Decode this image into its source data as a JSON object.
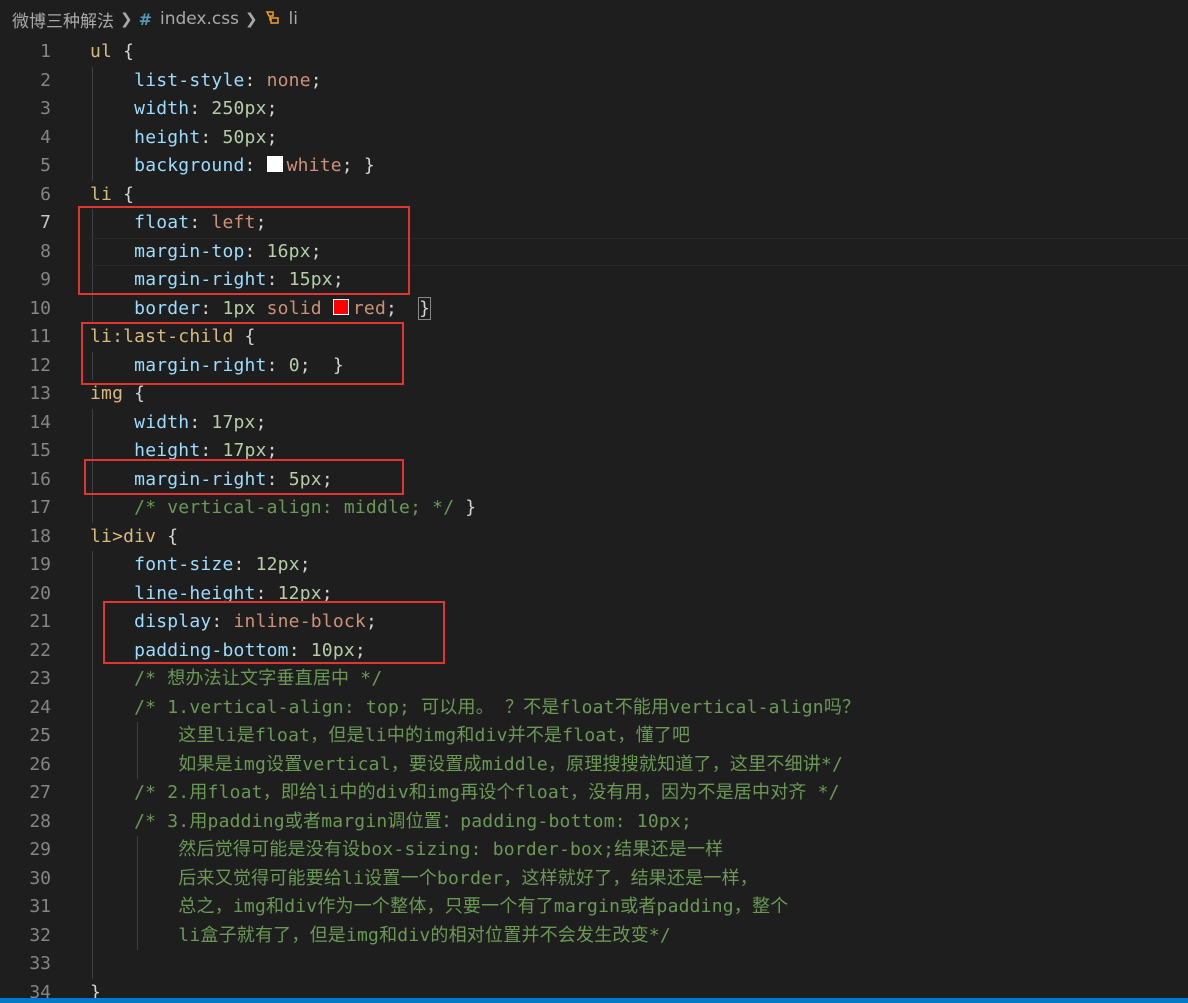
{
  "breadcrumb": {
    "folder": "微博三种解法",
    "file": "index.css",
    "symbol": "li",
    "file_icon": "hash-icon",
    "symbol_icon": "css-selector-icon"
  },
  "editor": {
    "lines": [
      {
        "n": "1",
        "text": "ul {"
      },
      {
        "n": "2",
        "text": "    list-style: none;"
      },
      {
        "n": "3",
        "text": "    width: 250px;"
      },
      {
        "n": "4",
        "text": "    height: 50px;"
      },
      {
        "n": "5",
        "text": "    background: white; }"
      },
      {
        "n": "6",
        "text": "li {"
      },
      {
        "n": "7",
        "text": "    float: left;"
      },
      {
        "n": "8",
        "text": "    margin-top: 16px;"
      },
      {
        "n": "9",
        "text": "    margin-right: 15px;"
      },
      {
        "n": "10",
        "text": "    border: 1px solid red;  }"
      },
      {
        "n": "11",
        "text": "li:last-child {"
      },
      {
        "n": "12",
        "text": "    margin-right: 0;  }"
      },
      {
        "n": "13",
        "text": "img {"
      },
      {
        "n": "14",
        "text": "    width: 17px;"
      },
      {
        "n": "15",
        "text": "    height: 17px;"
      },
      {
        "n": "16",
        "text": "    margin-right: 5px;"
      },
      {
        "n": "17",
        "text": "    /* vertical-align: middle; */ }"
      },
      {
        "n": "18",
        "text": "li>div {"
      },
      {
        "n": "19",
        "text": "    font-size: 12px;"
      },
      {
        "n": "20",
        "text": "    line-height: 12px;"
      },
      {
        "n": "21",
        "text": "    display: inline-block;"
      },
      {
        "n": "22",
        "text": "    padding-bottom: 10px;"
      },
      {
        "n": "23",
        "text": "    /* 想办法让文字垂直居中 */"
      },
      {
        "n": "24",
        "text": "    /* 1.vertical-align: top; 可以用。 ？不是float不能用vertical-align吗？"
      },
      {
        "n": "25",
        "text": "        这里li是float，但是li中的img和div并不是float，懂了吧"
      },
      {
        "n": "26",
        "text": "        如果是img设置vertical，要设置成middle，原理搜搜就知道了，这里不细讲*/"
      },
      {
        "n": "27",
        "text": "    /* 2.用float，即给li中的div和img再设个float，没有用，因为不是居中对齐 */"
      },
      {
        "n": "28",
        "text": "    /* 3.用padding或者margin调位置：padding-bottom: 10px;"
      },
      {
        "n": "29",
        "text": "        然后觉得可能是没有设box-sizing: border-box;结果还是一样"
      },
      {
        "n": "30",
        "text": "        后来又觉得可能要给li设置一个border，这样就好了，结果还是一样，"
      },
      {
        "n": "31",
        "text": "        总之，img和div作为一个整体，只要一个有了margin或者padding，整个"
      },
      {
        "n": "32",
        "text": "        li盒子就有了，但是img和div的相对位置并不会发生改变*/"
      },
      {
        "n": "33",
        "text": ""
      },
      {
        "n": "34",
        "text": "}"
      }
    ],
    "swatches": {
      "white": "#ffffff",
      "red": "#ff0000"
    },
    "highlight_color": "#e0362f"
  }
}
